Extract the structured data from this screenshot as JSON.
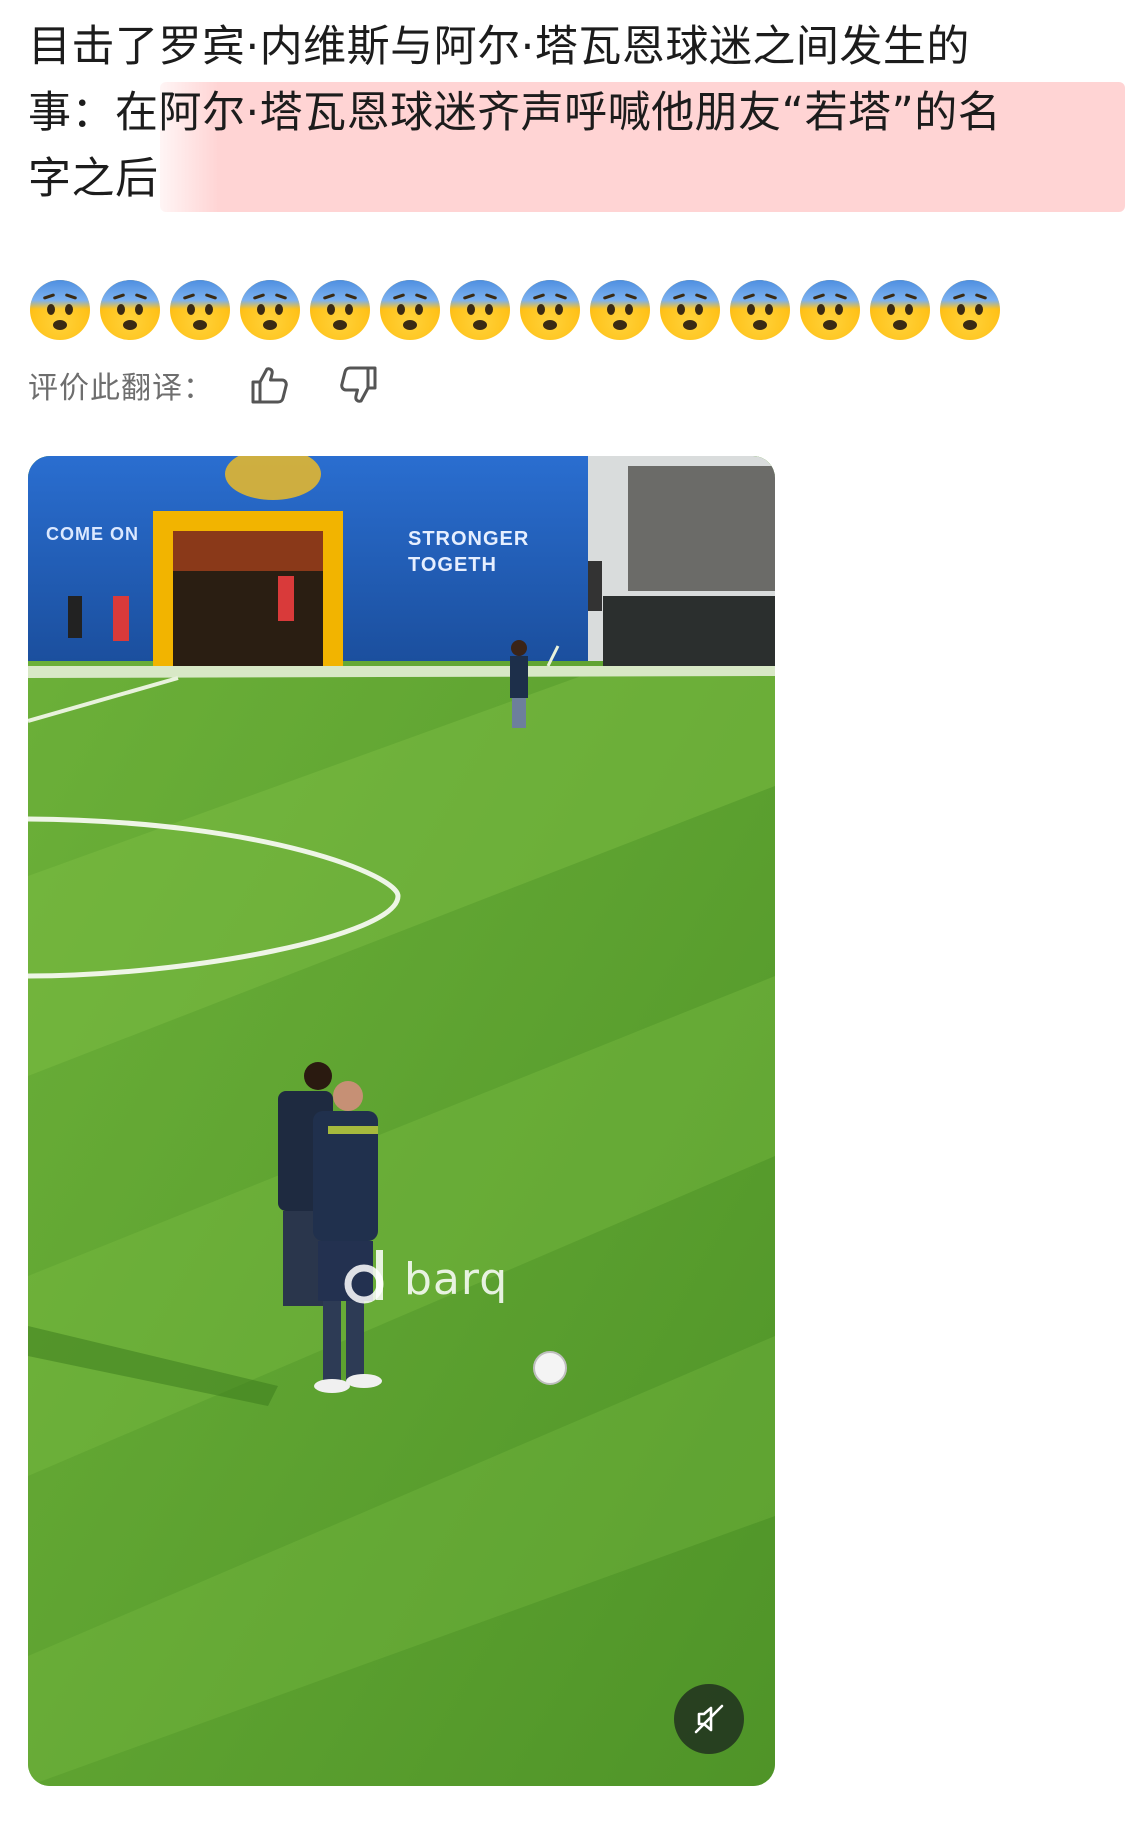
{
  "post": {
    "line1": "目击了罗宾·内维斯与阿尔·塔瓦恩球迷之间发生的",
    "line2": "事：在阿尔·塔瓦恩球迷齐声呼喊他朋友“若塔”的名",
    "line3": "字之后"
  },
  "emojis": {
    "name": "anxious-face-with-sweat",
    "count": 14
  },
  "rating": {
    "label": "评价此翻译：",
    "like_icon": "thumbs-up-icon",
    "dislike_icon": "thumbs-down-icon"
  },
  "video": {
    "banner_left": "COME ON",
    "banner_right_1": "STRONGER",
    "banner_right_2": "TOGETH",
    "watermark": "barq",
    "mute_icon": "muted-speaker-icon"
  },
  "colors": {
    "highlight": "#ffcdcd",
    "text": "#1c1c1c",
    "muted_text": "#6e6e6e",
    "pitch": "#5fa331",
    "stand": "#1f5fb8"
  }
}
